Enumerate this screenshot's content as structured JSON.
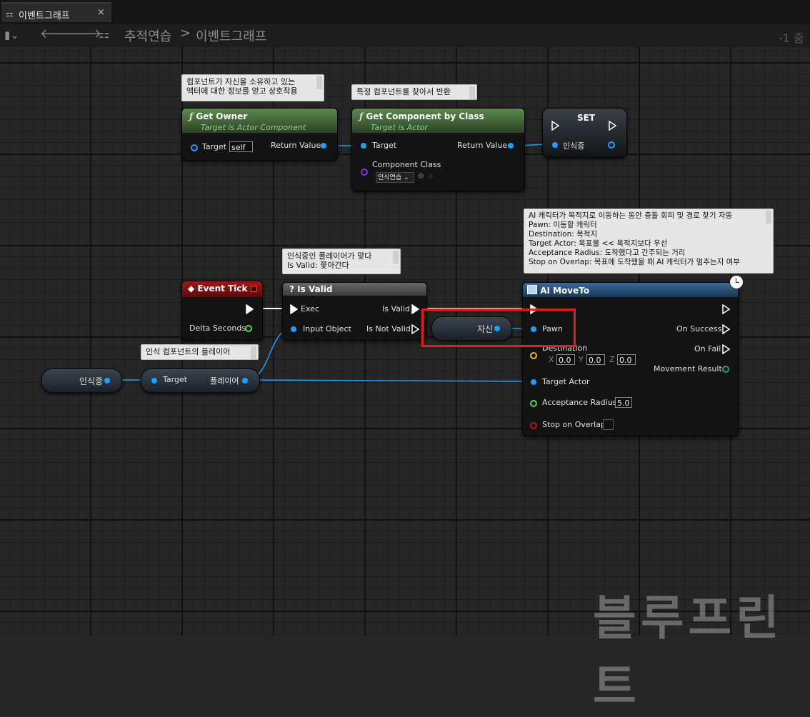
{
  "tab": {
    "title": "이벤트그래프",
    "close": "×"
  },
  "toolbar": {
    "breadcrumb_root": "추적연습",
    "breadcrumb_sep": ">",
    "breadcrumb_current": "이벤트그래프",
    "zoom": "-1 줌"
  },
  "comments": {
    "get_owner": "컴포넌트가 자신을 소유하고 있는\n액터에 대한 정보를 얻고 상호작용",
    "get_component": "특정 컴포넌트를 찾아서 반환",
    "is_valid": "인식중인 플레이어가 맞다\nIs Valid: 쫓아간다",
    "ai_moveto": "AI 캐릭터가 목적지로 이동하는 동안 충돌 회피 및 경로 찾기 자동\nPawn: 이동할 캐릭터\nDestination: 목적지\nTarget Actor: 목표물 << 목적지보다 우선\nAcceptance Radius: 도착했다고 간주되는 거리\nStop on Overlap: 목표에 도착했을 때 AI 캐릭터가 멈추는지 여부",
    "player": "인식 컴포넌트의 플레이어"
  },
  "nodes": {
    "get_owner": {
      "title": "Get Owner",
      "subtitle": "Target is Actor Component",
      "target_label": "Target",
      "target_value": "self",
      "return_label": "Return Value"
    },
    "get_component": {
      "title": "Get Component by Class",
      "subtitle": "Target is Actor",
      "target_label": "Target",
      "return_label": "Return Value",
      "class_label": "Component Class",
      "class_value": "인식연습"
    },
    "set": {
      "title": "SET",
      "var_label": "인식중"
    },
    "event_tick": {
      "title": "Event Tick",
      "delta_label": "Delta Seconds"
    },
    "is_valid": {
      "title": "Is Valid",
      "exec_label": "Exec",
      "input_label": "Input Object",
      "valid_label": "Is Valid",
      "not_valid_label": "Is Not Valid"
    },
    "ai_moveto": {
      "title": "AI MoveTo",
      "pawn_label": "Pawn",
      "destination_label": "Destination",
      "x_label": "X",
      "x_value": "0.0",
      "y_label": "Y",
      "y_value": "0.0",
      "z_label": "Z",
      "z_value": "0.0",
      "target_actor_label": "Target Actor",
      "acceptance_label": "Acceptance Radius",
      "acceptance_value": "5.0",
      "stop_label": "Stop on Overlap",
      "on_success": "On Success",
      "on_fail": "On Fail",
      "movement_result": "Movement Result"
    },
    "self_node": {
      "label": "자신"
    },
    "var_get": {
      "label": "인식중"
    },
    "player_get": {
      "target_label": "Target",
      "out_label": "플레이어"
    }
  },
  "watermark": "블루프린트"
}
